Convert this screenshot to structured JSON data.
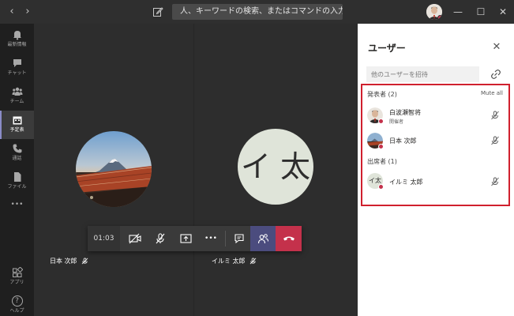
{
  "titlebar": {
    "back_glyph": "‹",
    "forward_glyph": "›",
    "search_placeholder": "人、キーワードの検索、またはコマンドの入力",
    "minimize_glyph": "—",
    "maximize_glyph": "☐",
    "close_glyph": "✕"
  },
  "rail": {
    "items": [
      {
        "label": "最新情報",
        "icon": "bell-icon"
      },
      {
        "label": "チャット",
        "icon": "chat-icon"
      },
      {
        "label": "チーム",
        "icon": "teams-icon"
      },
      {
        "label": "予定表",
        "icon": "calendar-icon",
        "active": true
      },
      {
        "label": "通話",
        "icon": "phone-icon"
      },
      {
        "label": "ファイル",
        "icon": "file-icon"
      },
      {
        "label": "",
        "icon": "more-icon"
      },
      {
        "label": "アプリ",
        "icon": "apps-icon"
      },
      {
        "label": "ヘルプ",
        "icon": "help-icon"
      }
    ],
    "more_glyph": "•••",
    "help_glyph": "?"
  },
  "stage": {
    "tile_left_name": "日本 次郎",
    "tile_right_name": "イルミ 太郎",
    "tile_right_initials": "イ 太"
  },
  "controls": {
    "timer": "01:03",
    "more_glyph": "•••"
  },
  "panel": {
    "title": "ユーザー",
    "close_glyph": "✕",
    "invite_placeholder": "他のユーザーを招待",
    "presenters_label": "発表者 (2)",
    "mute_all": "Mute all",
    "attendees_label": "出席者 (1)",
    "participants": [
      {
        "name": "白波瀬智将",
        "role": "開催者"
      },
      {
        "name": "日本 次郎",
        "role": ""
      },
      {
        "name": "イルミ 太郎",
        "role": "",
        "initials": "イ太"
      }
    ]
  },
  "colors": {
    "accent": "#6264a7",
    "hangup": "#c4314b",
    "highlight_box": "#d0202e"
  }
}
